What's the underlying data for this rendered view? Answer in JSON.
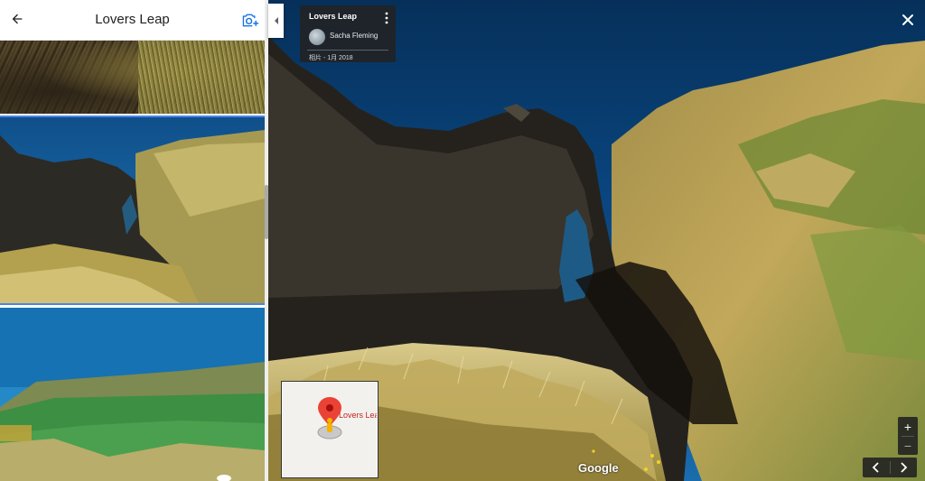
{
  "panel": {
    "title": "Lovers Leap",
    "back_icon": "arrow-left-icon",
    "add_photo_icon": "add-photo-camera-icon",
    "accent_color": "#1a73e8",
    "photos": [
      "photo-1",
      "photo-2",
      "photo-3"
    ]
  },
  "info_card": {
    "title": "Lovers Leap",
    "author": "Sacha Fleming",
    "date": "相片 - 1月 2018",
    "menu_icon": "more-vert-icon"
  },
  "map": {
    "label": "Lovers Leap",
    "pin_color": "#ea4335"
  },
  "zoom": {
    "in": "+",
    "out": "−"
  },
  "brand": "Google"
}
